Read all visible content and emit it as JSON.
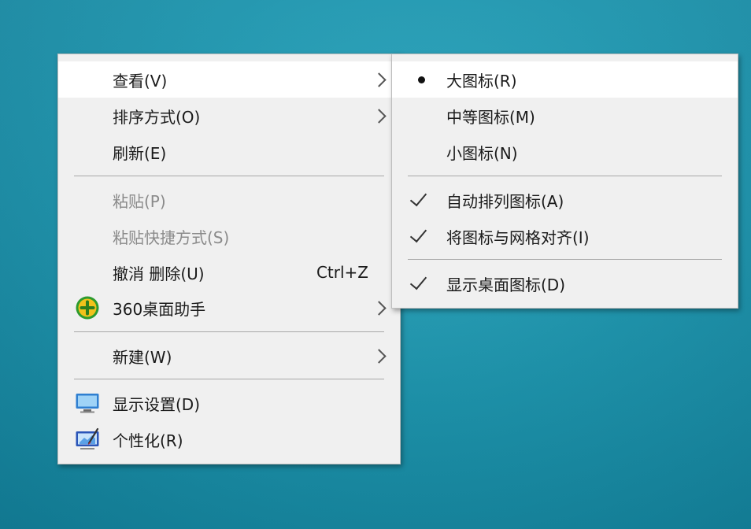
{
  "desktop": {
    "accent_color": "#1b94ad"
  },
  "main_menu": {
    "items": [
      {
        "label": "查看(V)",
        "has_submenu": true,
        "highlighted": true
      },
      {
        "label": "排序方式(O)",
        "has_submenu": true
      },
      {
        "label": "刷新(E)"
      },
      {
        "label": "粘贴(P)",
        "disabled": true
      },
      {
        "label": "粘贴快捷方式(S)",
        "disabled": true
      },
      {
        "label": "撤消 删除(U)",
        "shortcut": "Ctrl+Z"
      },
      {
        "label": "360桌面助手",
        "icon": "360-assistant-icon",
        "has_submenu": true
      },
      {
        "label": "新建(W)",
        "has_submenu": true
      },
      {
        "label": "显示设置(D)",
        "icon": "display-settings-icon"
      },
      {
        "label": "个性化(R)",
        "icon": "personalize-icon"
      }
    ]
  },
  "view_submenu": {
    "items": [
      {
        "label": "大图标(R)",
        "state": "selected-bullet"
      },
      {
        "label": "中等图标(M)"
      },
      {
        "label": "小图标(N)"
      },
      {
        "label": "自动排列图标(A)",
        "state": "checked"
      },
      {
        "label": "将图标与网格对齐(I)",
        "state": "checked"
      },
      {
        "label": "显示桌面图标(D)",
        "state": "checked"
      }
    ]
  }
}
